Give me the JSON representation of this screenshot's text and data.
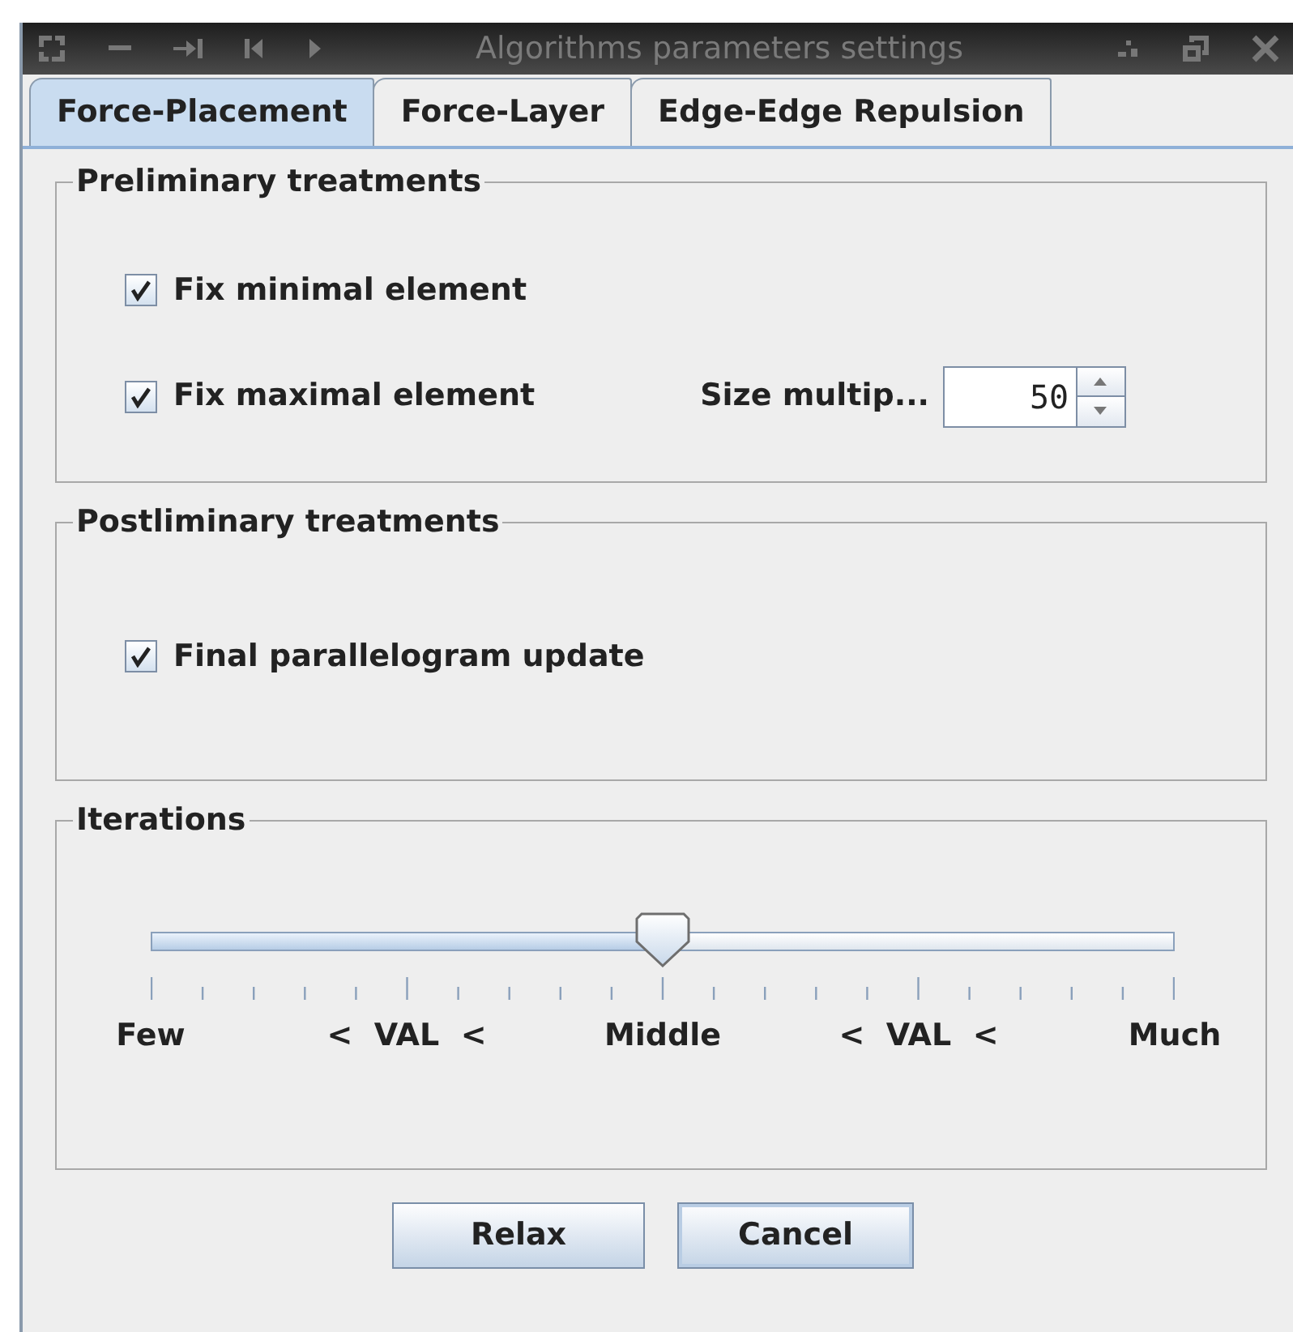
{
  "window": {
    "title": "Algorithms parameters settings"
  },
  "tabs": [
    {
      "label": "Force-Placement",
      "selected": true
    },
    {
      "label": "Force-Layer",
      "selected": false
    },
    {
      "label": "Edge-Edge Repulsion",
      "selected": false
    }
  ],
  "preliminary": {
    "title": "Preliminary treatments",
    "fix_minimal": {
      "label": "Fix minimal element",
      "checked": true
    },
    "fix_maximal": {
      "label": "Fix maximal element",
      "checked": true
    },
    "size_multiplier": {
      "label": "Size multip...",
      "value": "50"
    }
  },
  "postliminary": {
    "title": "Postliminary treatments",
    "final_update": {
      "label": "Final parallelogram update",
      "checked": true
    }
  },
  "iterations": {
    "title": "Iterations",
    "slider": {
      "level": 0.5,
      "labels": [
        "Few",
        "<  VAL  <",
        "Middle",
        "<  VAL  <",
        "Much"
      ]
    }
  },
  "buttons": [
    {
      "label": "Relax",
      "focused": false
    },
    {
      "label": "Cancel",
      "focused": true
    }
  ]
}
